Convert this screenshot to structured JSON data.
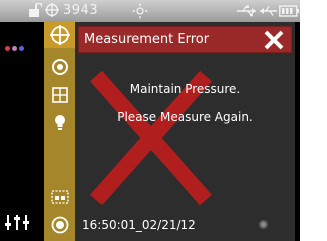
{
  "statusbar": {
    "counter": "3943",
    "icons": [
      "unlock-icon",
      "target-icon",
      "brightness-icon",
      "usb-icon",
      "usb-plug-icon",
      "battery-icon"
    ]
  },
  "sidebar": {
    "dots_colors": [
      "#d84040",
      "#c080c0",
      "#6060d8"
    ],
    "settings_icon": "sliders-icon"
  },
  "tools": [
    "measure-target-icon",
    "target-circle-icon",
    "grid-icon",
    "bulb-icon",
    "select-box-icon",
    "record-icon"
  ],
  "dialog": {
    "title": "Measurement Error",
    "line1": "Maintain Pressure.",
    "line2": "Please Measure Again.",
    "timestamp": "16:50:01_02/21/12"
  },
  "colors": {
    "title_bar": "#9a2a2a",
    "tool_column": "#a6862a",
    "error_x": "#b01e1e"
  }
}
